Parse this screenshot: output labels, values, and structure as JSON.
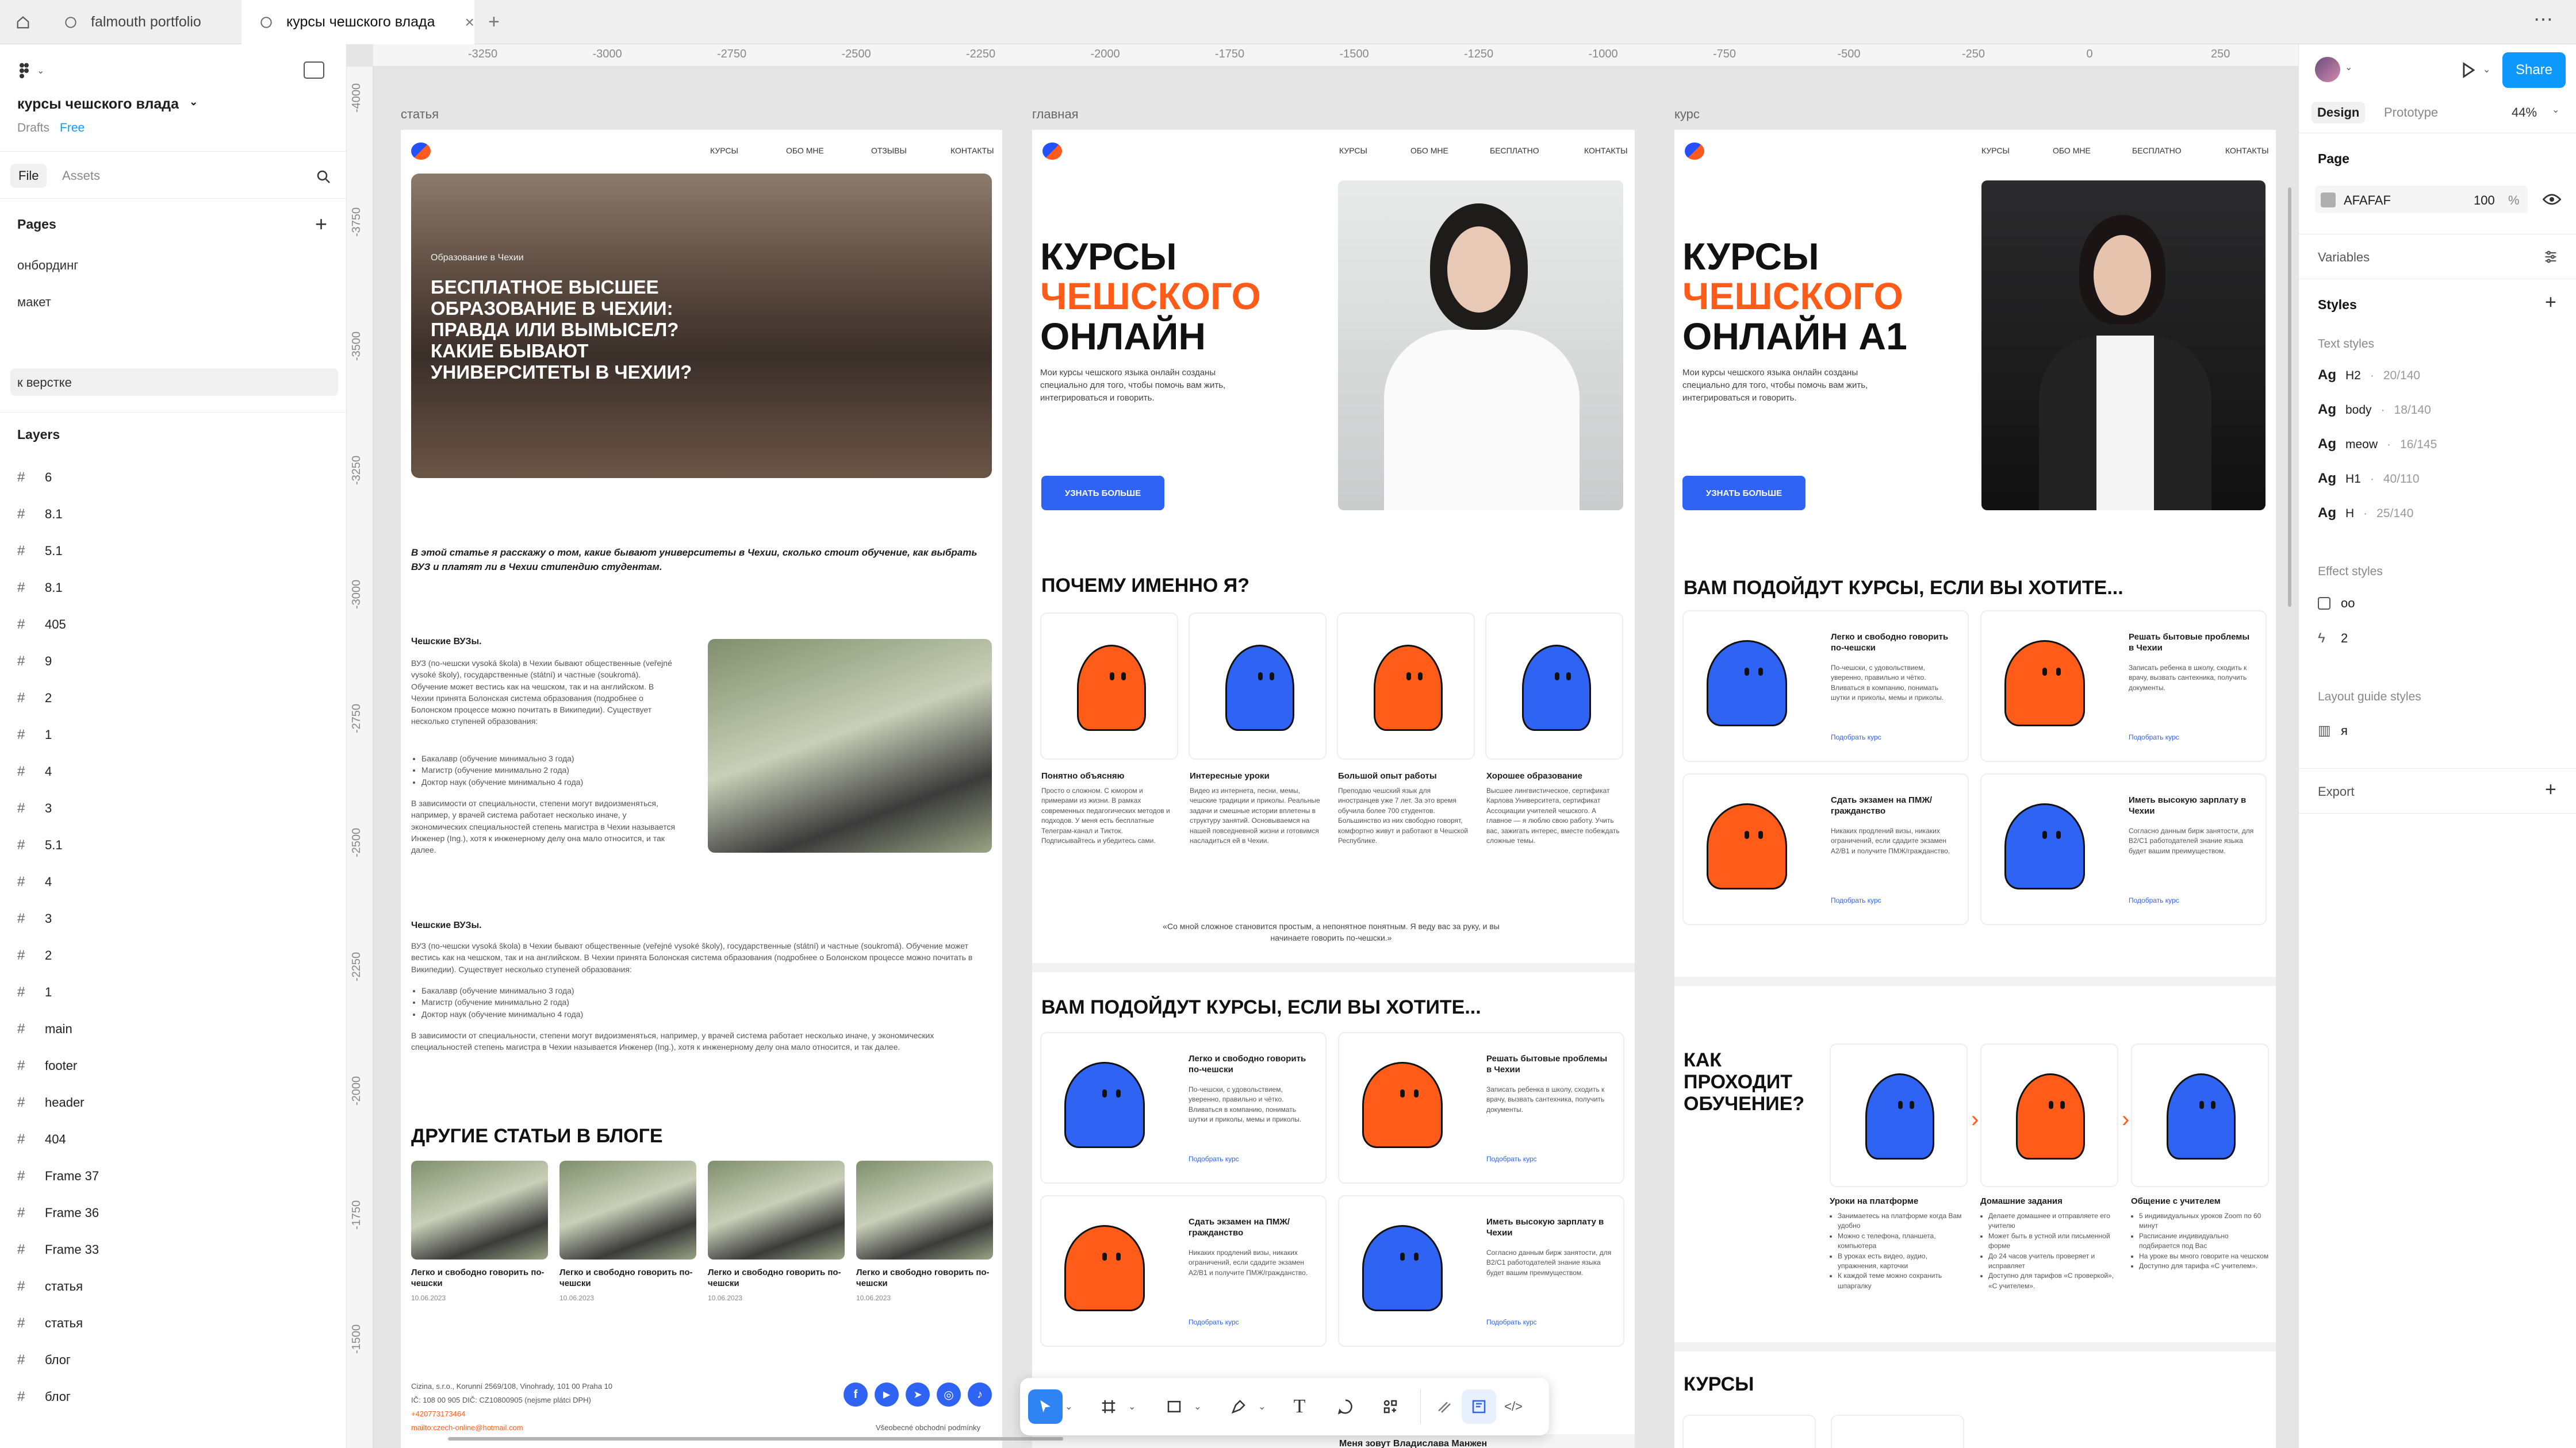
{
  "tabs": [
    {
      "label": "falmouth portfolio"
    },
    {
      "label": "курсы чешского влада"
    }
  ],
  "left": {
    "project_name": "курсы чешского влада",
    "drafts": "Drafts",
    "plan": "Free",
    "tab_file": "File",
    "tab_assets": "Assets",
    "pages_title": "Pages",
    "pages": [
      "онбординг",
      "макет",
      "к верстке"
    ],
    "layers_title": "Layers",
    "layers": [
      "6",
      "8.1",
      "5.1",
      "8.1",
      "405",
      "9",
      "2",
      "1",
      "4",
      "3",
      "5.1",
      "4",
      "3",
      "2",
      "1",
      "main",
      "footer",
      "header",
      "404",
      "Frame 37",
      "Frame 36",
      "Frame 33",
      "статья",
      "статья",
      "блог",
      "блог"
    ]
  },
  "ruler": {
    "top": [
      "-3250",
      "-3000",
      "-2750",
      "-2500",
      "-2250",
      "-2000",
      "-1750",
      "-1500",
      "-1250",
      "-1000",
      "-750",
      "-500",
      "-250",
      "0",
      "250"
    ],
    "left": [
      "-4000",
      "-3750",
      "-3500",
      "-3250",
      "-3000",
      "-2750",
      "-2500",
      "-2250",
      "-2000",
      "-1750",
      "-1500"
    ]
  },
  "frames": {
    "article": {
      "label": "статья",
      "nav": [
        "КУРСЫ",
        "ОБО МНЕ",
        "ОТЗЫВЫ",
        "КОНТАКТЫ"
      ],
      "hero_tag": "Образование в Чехии",
      "hero_title": "БЕСПЛАТНОЕ ВЫСШЕЕ ОБРАЗОВАНИЕ В ЧЕХИИ: ПРАВДА ИЛИ ВЫМЫСЕЛ? КАКИЕ БЫВАЮТ УНИВЕРСИТЕТЫ В ЧЕХИИ?",
      "intro": "В этой статье я расскажу о том, какие бывают университеты в Чехии, сколько стоит обучение, как выбрать ВУЗ и платят ли в Чехии стипендию студентам.",
      "s1_title": "Чешские ВУЗы.",
      "s1_text": "ВУЗ (по-чешски vysoká škola) в Чехии бывают общественные (veřejné vysoké školy), государственные (státní) и частные (soukromá). Обучение может вестись как на чешском, так и на английском. В Чехии принята Болонская система образования (подробнее о Болонском процессе можно почитать в Википедии). Существует несколько ступеней образования:",
      "s1_list": [
        "Бакалавр (обучение минимально 3 года)",
        "Магистр (обучение минимально 2 года)",
        "Доктор наук (обучение минимально 4 года)"
      ],
      "s1_after": "В зависимости от специальности, степени могут видоизменяться, например, у врачей система работает несколько иначе, у экономических специальностей степень магистра в Чехии называется Инженер (Ing.), хотя к инженерному делу она мало относится, и так далее.",
      "s2_title": "Чешские ВУЗы.",
      "s2_text": "ВУЗ (по-чешски vysoká škola) в Чехии бывают общественные (veřejné vysoké školy), государственные (státní) и частные (soukromá). Обучение может вестись как на чешском, так и на английском. В Чехии принята Болонская система образования (подробнее о Болонском процессе можно почитать в Википедии). Существует несколько ступеней образования:",
      "s2_list": [
        "Бакалавр (обучение минимально 3 года)",
        "Магистр (обучение минимально 2 года)",
        "Доктор наук (обучение минимально 4 года)"
      ],
      "s2_after": "В зависимости от специальности, степени могут видоизменяться, например, у врачей система работает несколько иначе, у экономических специальностей степень магистра в Чехии называется Инженер (Ing.), хотя к инженерному делу она мало относится, и так далее.",
      "blog_title": "ДРУГИЕ СТАТЬИ В БЛОГЕ",
      "blog_cards": [
        {
          "title": "Легко и свободно говорить по-чешски",
          "date": "10.06.2023"
        },
        {
          "title": "Легко и свободно говорить по-чешски",
          "date": "10.06.2023"
        },
        {
          "title": "Легко и свободно говорить по-чешски",
          "date": "10.06.2023"
        },
        {
          "title": "Легко и свободно говорить по-чешски",
          "date": "10.06.2023"
        }
      ],
      "footer_addr": "Cizina, s.r.o., Korunní 2569/108, Vinohrady, 101 00 Praha 10",
      "footer_ic": "IČ: 108 00 905 DIČ: CZ10800905 (nejsme plátci DPH)",
      "footer_phone": "+420773173464",
      "footer_mail": "mailto:czech-online@hotmail.com",
      "footer_terms": "Všeobecné obchodní podmínky"
    },
    "main": {
      "label": "главная",
      "nav": [
        "КУРСЫ",
        "ОБО МНЕ",
        "БЕСПЛАТНО",
        "КОНТАКТЫ"
      ],
      "hero_l1": "КУРСЫ",
      "hero_l2": "ЧЕШСКОГО",
      "hero_l3": "ОНЛАЙН",
      "hero_desc": "Мои курсы чешского языка онлайн созданы специально для того, чтобы помочь вам жить, интегрироваться и говорить.",
      "cta": "УЗНАТЬ БОЛЬШЕ",
      "why_title": "ПОЧЕМУ ИМЕННО Я?",
      "why": [
        {
          "title": "Понятно объясняю",
          "text": "Просто о сложном. С юмором и примерами из жизни. В рамках современных педагогических методов и подходов. У меня есть бесплатные Телеграм-канал и Тикток. Подписывайтесь и убедитесь сами."
        },
        {
          "title": "Интересные уроки",
          "text": "Видео из интернета, песни, мемы, чешские традиции и приколы. Реальные задачи и смешные истории вплетены в структуру занятий. Основываемся на нашей повседневной жизни и готовимся насладиться ей в Чехии."
        },
        {
          "title": "Большой опыт работы",
          "text": "Преподаю чешский язык для иностранцев уже 7 лет. За это время обучила более 700 студентов. Большинство из них свободно говорят, комфортно живут и работают в Чешской Республике."
        },
        {
          "title": "Хорошее образование",
          "text": "Высшее лингвистическое, сертификат Карлова Университета, сертификат Ассоциации учителей чешского. А главное — я люблю свою работу. Учить вас, зажигать интерес, вместе побеждать сложные темы."
        }
      ],
      "quote": "«Со мной сложное становится простым, а непонятное понятным. Я веду вас за руку, и вы начинаете говорить по-чешски.»",
      "fit_title": "ВАМ ПОДОЙДУТ КУРСЫ, ЕСЛИ ВЫ ХОТИТЕ...",
      "fit": [
        {
          "title": "Легко и свободно говорить по-чешски",
          "text": "По-чешски, с удовольствием, уверенно, правильно и чётко. Вливаться в компанию, понимать шутки и приколы, мемы и приколы.",
          "link": "Подобрать курс"
        },
        {
          "title": "Решать бытовые проблемы в Чехии",
          "text": "Записать ребенка в школу, сходить к врачу, вызвать сантехника, получить документы.",
          "link": "Подобрать курс"
        },
        {
          "title": "Сдать экзамен на ПМЖ/гражданство",
          "text": "Никаких продлений визы, никаких ограничений, если сдадите экзамен А2/В1 и получите ПМЖ/гражданство.",
          "link": "Подобрать курс"
        },
        {
          "title": "Иметь высокую зарплату в Чехии",
          "text": "Согласно данным бирж занятости, для B2/С1 работодателей знание языка будет вашим преимуществом.",
          "link": "Подобрать курс"
        }
      ],
      "next_title": "Меня зовут Владислава Манжен"
    },
    "course": {
      "label": "курс",
      "nav": [
        "КУРСЫ",
        "ОБО МНЕ",
        "БЕСПЛАТНО",
        "КОНТАКТЫ"
      ],
      "hero_l1": "КУРСЫ",
      "hero_l2": "ЧЕШСКОГО",
      "hero_l3": "ОНЛАЙН А1",
      "hero_desc": "Мои курсы чешского языка онлайн созданы специально для того, чтобы помочь вам жить, интегрироваться и говорить.",
      "cta": "УЗНАТЬ БОЛЬШЕ",
      "fit_title": "ВАМ ПОДОЙДУТ КУРСЫ, ЕСЛИ ВЫ ХОТИТЕ...",
      "fit": [
        {
          "title": "Легко и свободно говорить по-чешски",
          "text": "По-чешски, с удовольствием, уверенно, правильно и чётко. Вливаться в компанию, понимать шутки и приколы, мемы и приколы.",
          "link": "Подобрать курс"
        },
        {
          "title": "Решать бытовые проблемы в Чехии",
          "text": "Записать ребенка в школу, сходить к врачу, вызвать сантехника, получить документы.",
          "link": "Подобрать курс"
        },
        {
          "title": "Сдать экзамен на ПМЖ/гражданство",
          "text": "Никаких продлений визы, никаких ограничений, если сдадите экзамен А2/В1 и получите ПМЖ/гражданство.",
          "link": "Подобрать курс"
        },
        {
          "title": "Иметь высокую зарплату в Чехии",
          "text": "Согласно данным бирж занятости, для B2/С1 работодателей знание языка будет вашим преимуществом.",
          "link": "Подобрать курс"
        }
      ],
      "how_title": "КАК ПРОХОДИТ ОБУЧЕНИЕ?",
      "how": [
        {
          "title": "Уроки на платформе",
          "items": [
            "Занимаетесь на платформе когда Вам удобно",
            "Можно с телефона, планшета, компьютера",
            "В уроках есть видео, аудио, упражнения, карточки",
            "К каждой теме можно сохранить шпаргалку"
          ]
        },
        {
          "title": "Домашние задания",
          "items": [
            "Делаете домашнее и отправляете его учителю",
            "Может быть в устной или письменной форме",
            "До 24 часов учитель проверяет и исправляет",
            "Доступно для тарифов «С проверкой», «С учителем»."
          ]
        },
        {
          "title": "Общение с учителем",
          "items": [
            "5 индивидуальных уроков Zoom по 60 минут",
            "Расписание индивидуально подбирается под Вас",
            "На уроке вы много говорите на чешском",
            "Доступно для тарифа «С учителем»."
          ]
        }
      ],
      "courses_title": "КУРСЫ"
    }
  },
  "right": {
    "tab_design": "Design",
    "tab_prototype": "Prototype",
    "zoom": "44%",
    "share": "Share",
    "page_title": "Page",
    "page_color": "AFAFAF",
    "page_opacity": "100",
    "pct": "%",
    "variables": "Variables",
    "styles": "Styles",
    "text_styles_title": "Text styles",
    "text_styles": [
      {
        "name": "H2",
        "meta": "20/140"
      },
      {
        "name": "body",
        "meta": "18/140"
      },
      {
        "name": "meow",
        "meta": "16/145"
      },
      {
        "name": "H1",
        "meta": "40/110"
      },
      {
        "name": "H",
        "meta": "25/140"
      }
    ],
    "effect_styles_title": "Effect styles",
    "effect_styles": [
      "oo",
      "2"
    ],
    "layout_guides_title": "Layout guide styles",
    "layout_guides": [
      "я"
    ],
    "export": "Export",
    "help": "?"
  },
  "colors": {
    "accent": "#2f63f4",
    "orange": "#ff5c1a",
    "share": "#0d99ff",
    "canvas": "#e5e5e5"
  }
}
